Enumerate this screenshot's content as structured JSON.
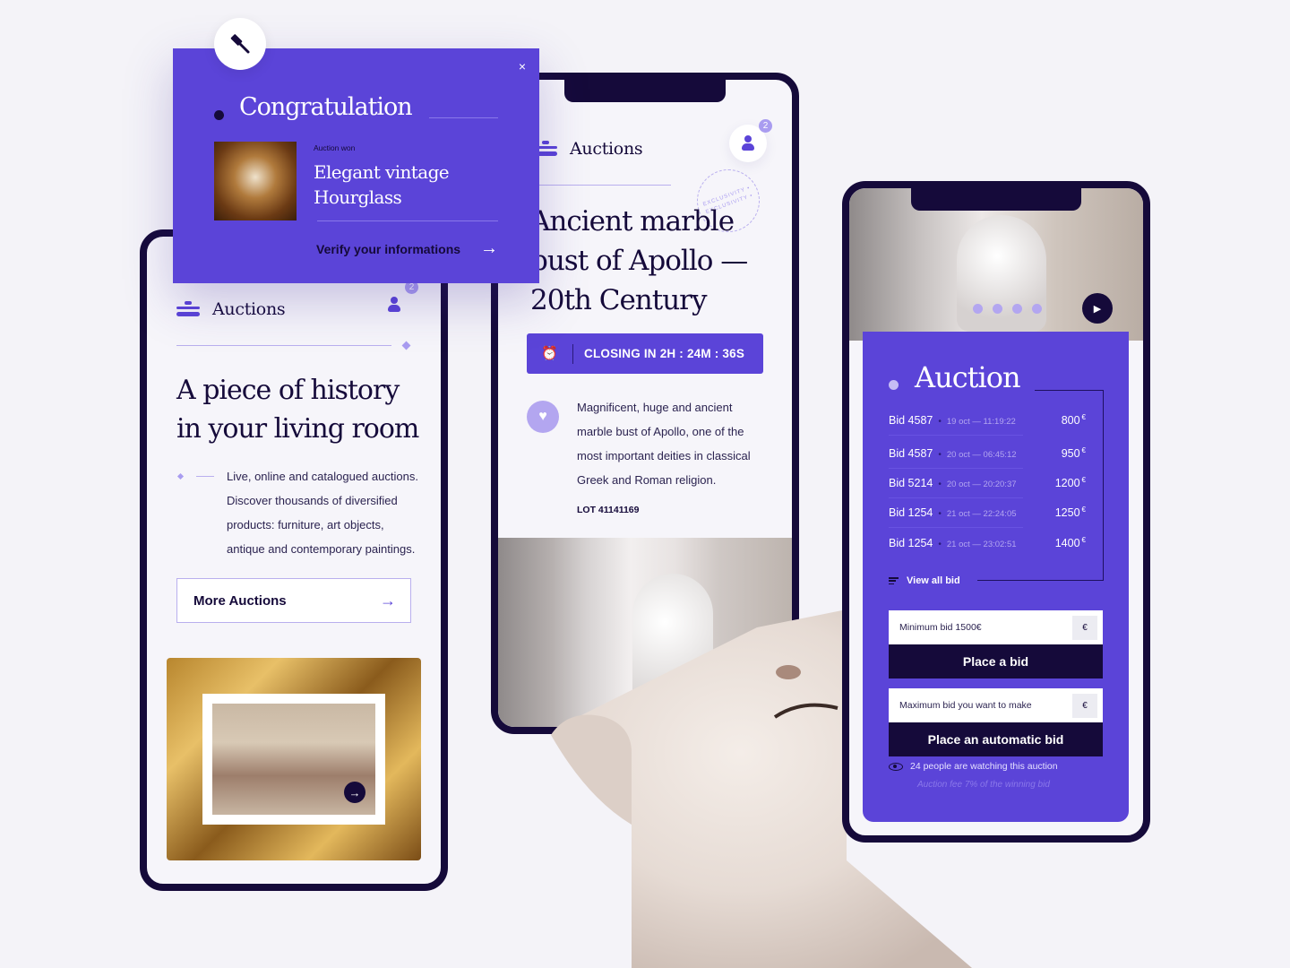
{
  "popup": {
    "title": "Congratulation",
    "won_label": "Auction won",
    "item_name_line1": "Elegant vintage",
    "item_name_line2": "Hourglass",
    "verify_label": "Verify your informations",
    "close_glyph": "×",
    "arrow_glyph": "→",
    "icon": "gavel-icon"
  },
  "left_phone": {
    "header": {
      "title": "Auctions",
      "badge": "2"
    },
    "headline_line1": "A piece of history",
    "headline_line2": "in your living room",
    "body_lines": [
      "Live, online and catalogued auctions.",
      "Discover thousands of diversified",
      "products: furniture, art objects,",
      "antique and contemporary paintings."
    ],
    "more_button": "More Auctions",
    "arrow_glyph": "→"
  },
  "mid_phone": {
    "header": {
      "title": "Auctions",
      "badge": "2"
    },
    "headline_line1": "Ancient marble",
    "headline_line2": "bust of Apollo —",
    "headline_line3": "20th Century",
    "stamp_text": "EXCLUSIVITY • EXCLUSIVITY •",
    "closing": "CLOSING IN 2H : 24M : 36S",
    "alarm_glyph": "⏰",
    "heart_glyph": "♥",
    "description_lines": [
      "Magnificent, huge and ancient",
      "marble bust of Apollo, one of the",
      "most important deities in classical",
      "Greek and Roman religion."
    ],
    "lot": "LOT 41141169"
  },
  "right_phone": {
    "carousel_dots": 4,
    "play_glyph": "▶",
    "title": "Auction",
    "bids": [
      {
        "name": "Bid 4587",
        "date": "19 oct — 11:19:22",
        "amount": "800",
        "currency": "€"
      },
      {
        "name": "Bid 4587",
        "date": "20 oct — 06:45:12",
        "amount": "950",
        "currency": "€"
      },
      {
        "name": "Bid 5214",
        "date": "20 oct — 20:20:37",
        "amount": "1200",
        "currency": "€"
      },
      {
        "name": "Bid 1254",
        "date": "21 oct — 22:24:05",
        "amount": "1250",
        "currency": "€"
      },
      {
        "name": "Bid 1254",
        "date": "21 oct — 23:02:51",
        "amount": "1400",
        "currency": "€"
      }
    ],
    "view_all": "View all bid",
    "min_bid_placeholder": "Minimum bid 1500€",
    "max_bid_placeholder": "Maximum bid you want to make",
    "currency_symbol": "€",
    "place_bid": "Place a bid",
    "place_auto_bid": "Place an automatic bid",
    "watching": "24 people are watching this auction",
    "fee": "Auction fee 7% of the winning bid"
  },
  "colors": {
    "accent": "#5b44d8",
    "dark": "#150a3a",
    "light_accent": "#b3a6f0",
    "background": "#f4f3f8"
  }
}
